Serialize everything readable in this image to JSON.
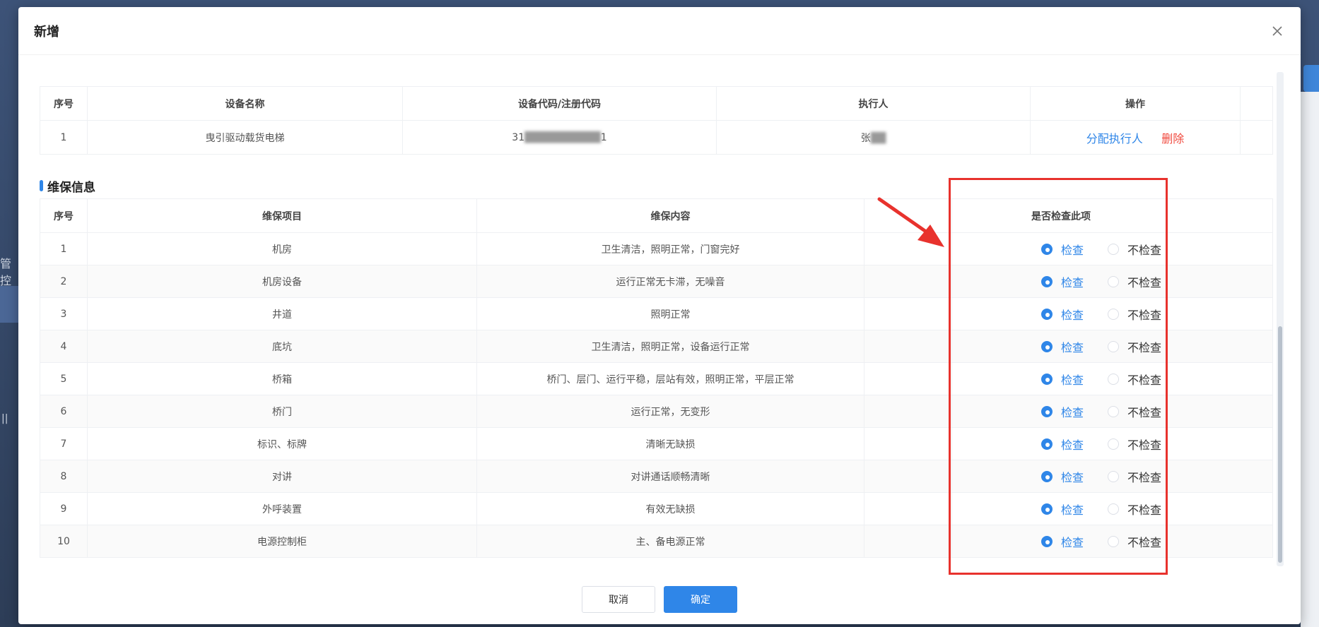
{
  "modal": {
    "title": "新增"
  },
  "equipment_table": {
    "headers": [
      "序号",
      "设备名称",
      "设备代码/注册代码",
      "执行人",
      "操作"
    ],
    "rows": [
      {
        "index": "1",
        "name": "曳引驱动载货电梯",
        "code_prefix": "31",
        "code_suffix": "1",
        "executor": "张",
        "assign_label": "分配执行人",
        "delete_label": "删除"
      }
    ]
  },
  "maintenance": {
    "section_title": "维保信息",
    "headers": [
      "序号",
      "维保项目",
      "维保内容",
      "",
      "是否检查此项"
    ],
    "check_label": "检查",
    "no_check_label": "不检查",
    "rows": [
      {
        "index": "1",
        "item": "机房",
        "content": "卫生清洁，照明正常，门窗完好",
        "checked": true
      },
      {
        "index": "2",
        "item": "机房设备",
        "content": "运行正常无卡滞，无噪音",
        "checked": true
      },
      {
        "index": "3",
        "item": "井道",
        "content": "照明正常",
        "checked": true
      },
      {
        "index": "4",
        "item": "底坑",
        "content": "卫生清洁，照明正常，设备运行正常",
        "checked": true
      },
      {
        "index": "5",
        "item": "桥箱",
        "content": "桥门、层门、运行平稳，层站有效，照明正常，平层正常",
        "checked": true
      },
      {
        "index": "6",
        "item": "桥门",
        "content": "运行正常，无变形",
        "checked": true
      },
      {
        "index": "7",
        "item": "标识、标牌",
        "content": "清晰无缺损",
        "checked": true
      },
      {
        "index": "8",
        "item": "对讲",
        "content": "对讲通话顺畅清晰",
        "checked": true
      },
      {
        "index": "9",
        "item": "外呼装置",
        "content": "有效无缺损",
        "checked": true
      },
      {
        "index": "10",
        "item": "电源控制柜",
        "content": "主、备电源正常",
        "checked": true
      }
    ]
  },
  "footer": {
    "cancel_label": "取消",
    "ok_label": "确定"
  },
  "background": {
    "left_text": "管控",
    "left_mark": "||"
  },
  "colors": {
    "primary": "#2f86e8",
    "danger": "#f0493e",
    "highlight": "#e8322d"
  }
}
